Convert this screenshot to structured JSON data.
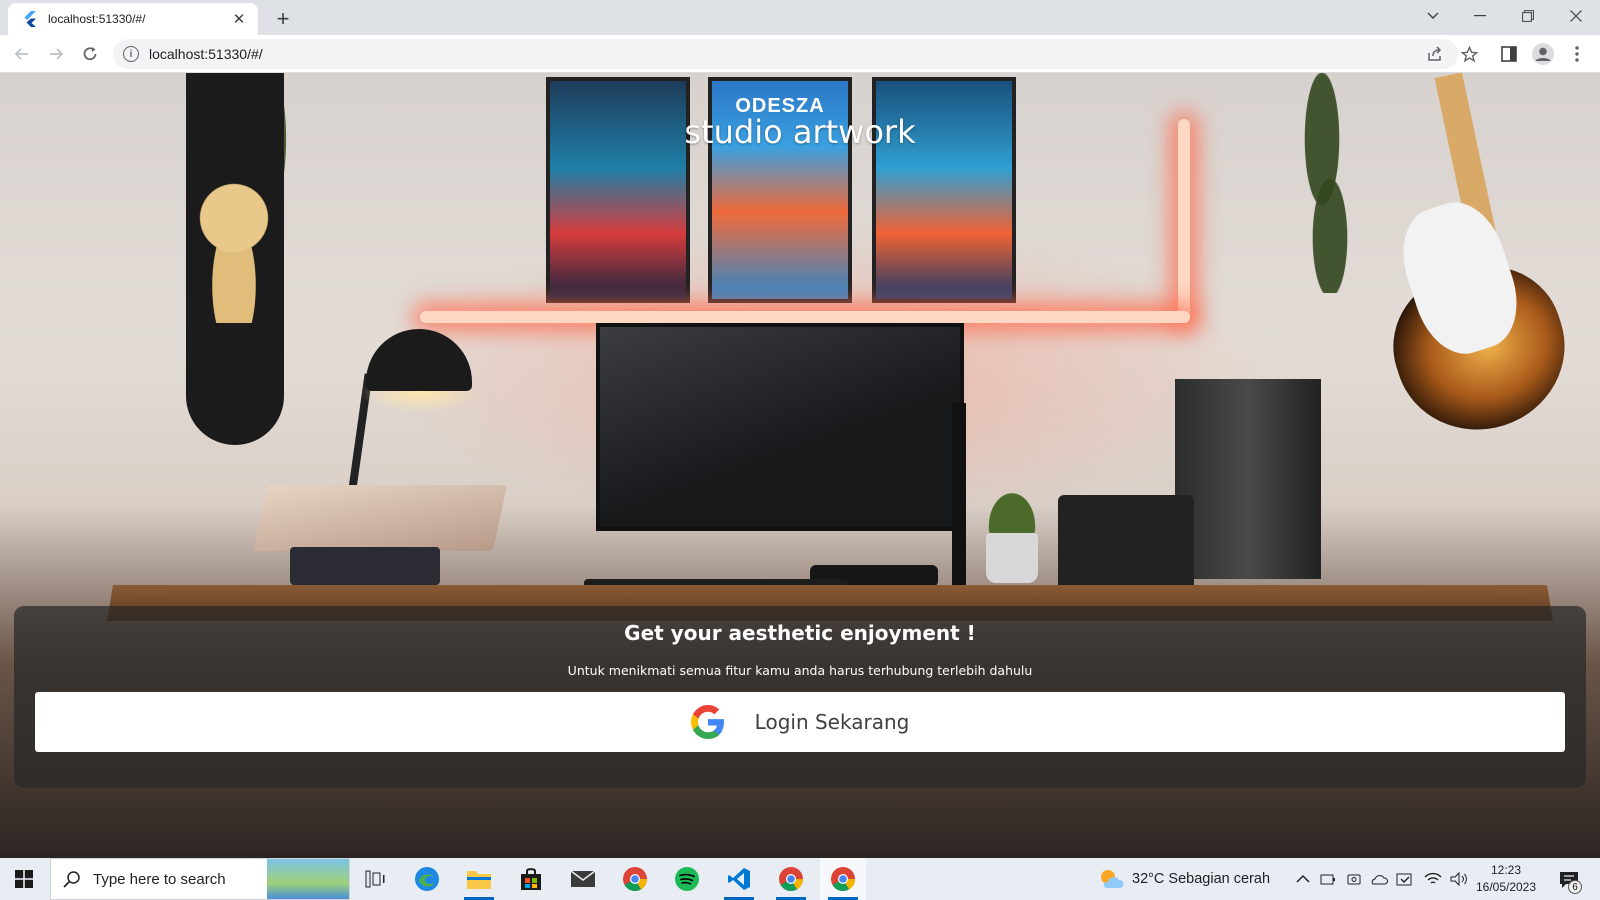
{
  "browser": {
    "tab_title": "localhost:51330/#/",
    "url": "localhost:51330/#/"
  },
  "app": {
    "title": "studio artwork",
    "poster_text": "ODESZA",
    "headline": "Get your aesthetic enjoyment !",
    "subtitle": "Untuk menikmati semua fitur kamu anda harus terhubung terlebih dahulu",
    "login_button_label": "Login Sekarang"
  },
  "taskbar": {
    "search_placeholder": "Type here to search",
    "weather": "32°C  Sebagian cerah",
    "time": "12:23",
    "date": "16/05/2023",
    "notification_count": "6",
    "apps": [
      "task-view",
      "edge",
      "file-explorer",
      "store",
      "mail",
      "chrome",
      "spotify",
      "vscode",
      "chrome",
      "chrome"
    ]
  },
  "colors": {
    "accent": "#0067c0",
    "panel_overlay": "rgba(40,40,40,0.72)",
    "neon": "#ff6e50"
  }
}
